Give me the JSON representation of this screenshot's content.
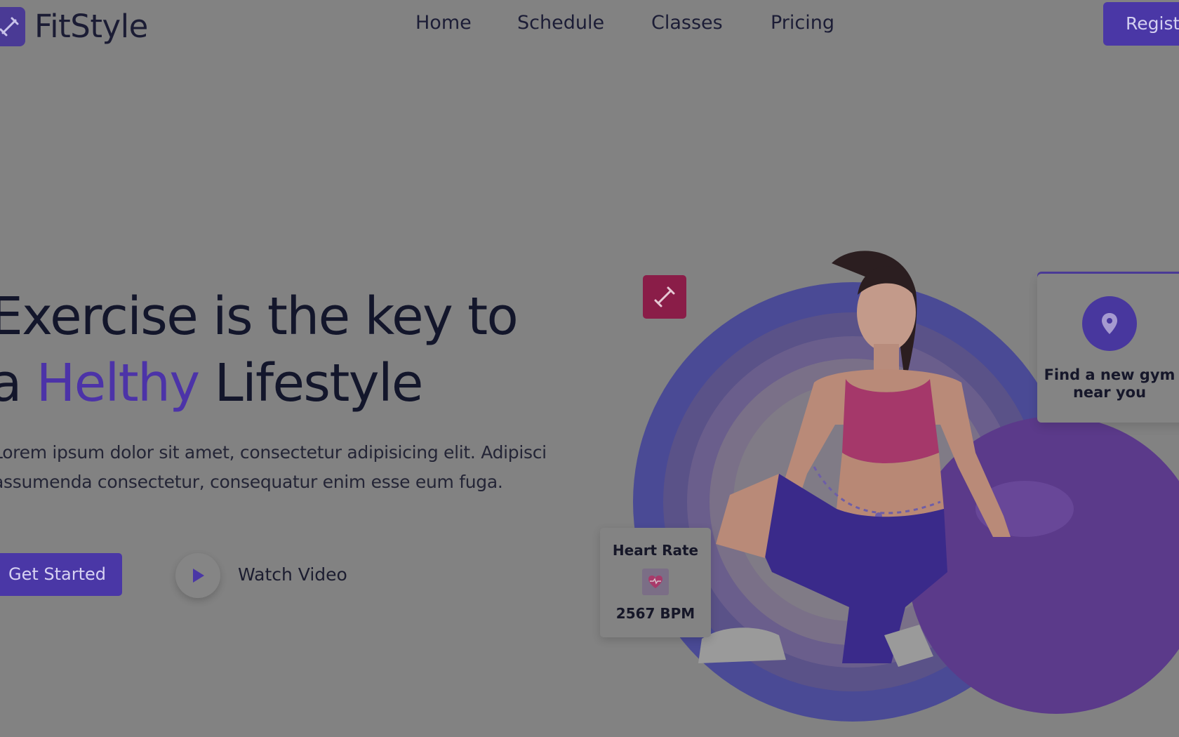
{
  "header": {
    "brand": "FitStyle",
    "nav": [
      "Home",
      "Schedule",
      "Classes",
      "Pricing"
    ],
    "register_label": "Register"
  },
  "hero": {
    "headline_line1": "Exercise is the key to",
    "headline_line2_pre": "a ",
    "headline_accent": "Helthy",
    "headline_line2_post": " Lifestyle",
    "lead_line1": "Lorem ipsum dolor sit amet, consectetur adipisicing elit. Adipisci",
    "lead_line2": "assumenda consectetur, consequatur enim esse eum fuga.",
    "cta_primary": "Get Started",
    "cta_secondary": "Watch Video"
  },
  "cards": {
    "gym_finder": "Find a new gym near you",
    "heart_rate_title": "Heart Rate",
    "heart_rate_value": "2567 BPM"
  },
  "colors": {
    "brand_purple": "#4a37a6",
    "accent_text": "#4c33a8",
    "badge_magenta": "#8a1d48",
    "page_bg": "#828282"
  },
  "icons": {
    "logo": "dumbbell-icon",
    "badge": "dumbbell-icon",
    "play": "play-icon",
    "gym": "location-pin-icon",
    "heart": "heart-pulse-icon"
  }
}
